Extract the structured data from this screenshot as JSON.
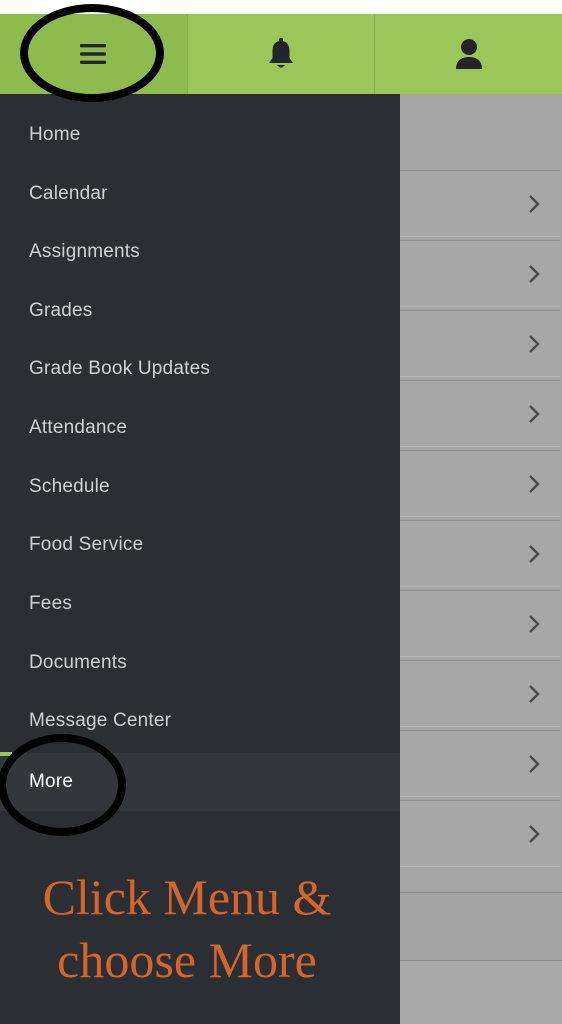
{
  "topbar": {
    "tabs": [
      {
        "icon": "menu-icon"
      },
      {
        "icon": "bell-icon"
      },
      {
        "icon": "user-icon"
      }
    ]
  },
  "drawer": {
    "items": [
      {
        "label": "Home"
      },
      {
        "label": "Calendar"
      },
      {
        "label": "Assignments"
      },
      {
        "label": "Grades"
      },
      {
        "label": "Grade Book Updates"
      },
      {
        "label": "Attendance"
      },
      {
        "label": "Schedule"
      },
      {
        "label": "Food Service"
      },
      {
        "label": "Fees"
      },
      {
        "label": "Documents"
      },
      {
        "label": "Message Center"
      },
      {
        "label": "More",
        "active": true
      }
    ]
  },
  "instruction": {
    "line1": "Click Menu &",
    "line2": "choose More"
  },
  "colors": {
    "nav_green": "#9bc75a",
    "drawer_bg": "#2b2e32",
    "annotation_orange": "#d2662e",
    "annotation_circle": "#000000"
  }
}
